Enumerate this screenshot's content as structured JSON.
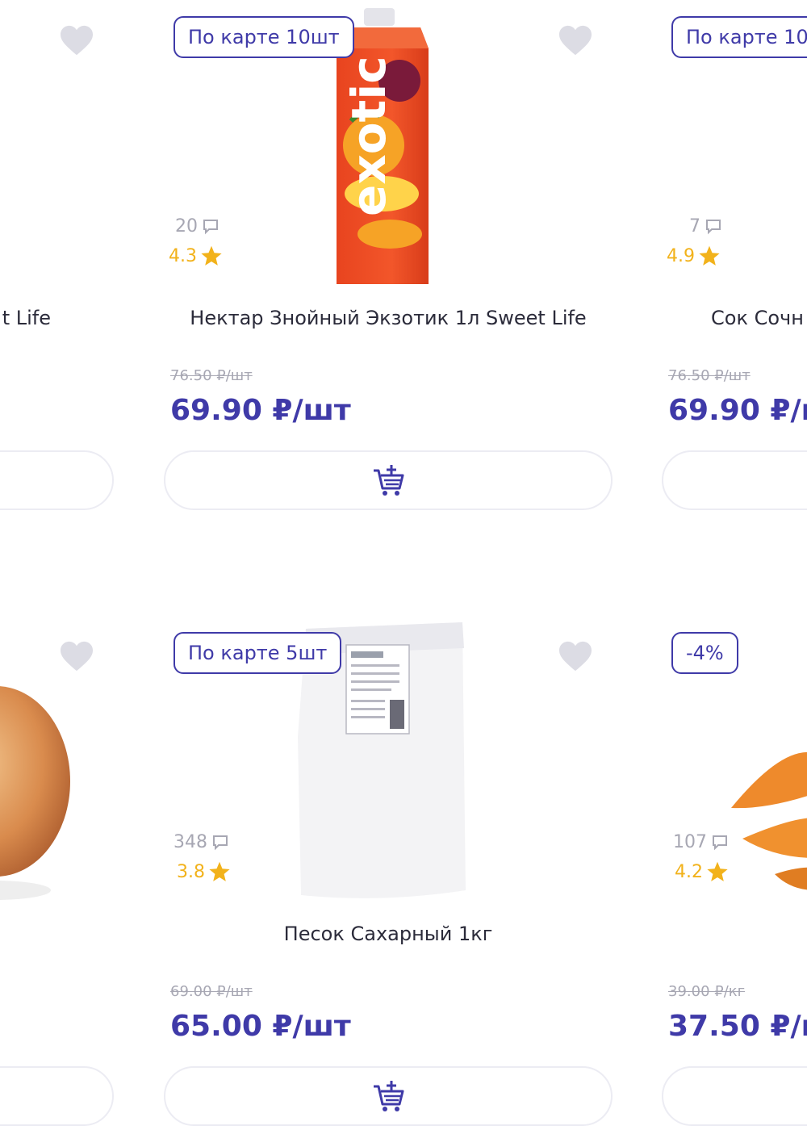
{
  "colors": {
    "accent": "#3f3aa8",
    "rating": "#f2b21b",
    "muted": "#a7a7b3",
    "heart": "#dcdce4"
  },
  "icons": {
    "favorite": "heart-icon",
    "reviews": "comment-icon",
    "rating": "star-icon",
    "cart": "add-to-cart-icon"
  },
  "products": [
    {
      "badge": "",
      "reviews": "",
      "rating": "",
      "title": "t Life",
      "old_price": "",
      "price": ""
    },
    {
      "badge": "По карте 10шт",
      "reviews": "20",
      "rating": "4.3",
      "title": "Нектар Знойный Экзотик 1л Sweet Life",
      "old_price": "76.50 ₽/шт",
      "price": "69.90 ₽/шт",
      "image_text": "exotic"
    },
    {
      "badge": "По карте 10",
      "reviews": "7",
      "rating": "4.9",
      "title": "Сок Сочн",
      "old_price": "76.50 ₽/шт",
      "price": "69.90 ₽/ш"
    },
    {
      "badge": "",
      "reviews": "",
      "rating": "",
      "title": "",
      "old_price": "",
      "price": ""
    },
    {
      "badge": "По карте 5шт",
      "reviews": "348",
      "rating": "3.8",
      "title": "Песок Сахарный 1кг",
      "old_price": "69.00 ₽/шт",
      "price": "65.00 ₽/шт"
    },
    {
      "badge": "-4%",
      "reviews": "107",
      "rating": "4.2",
      "title": "",
      "old_price": "39.00 ₽/кг",
      "price": "37.50 ₽/кг"
    }
  ]
}
